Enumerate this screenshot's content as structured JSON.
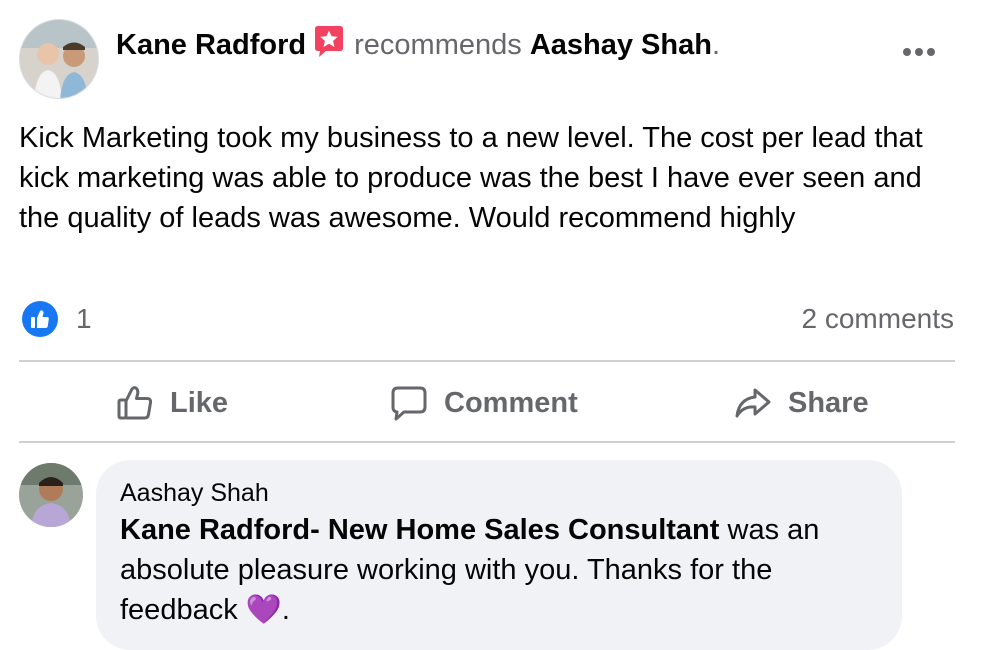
{
  "post": {
    "author": "Kane Radford",
    "verb": "recommends",
    "target": "Aashay Shah",
    "target_suffix": ".",
    "text": "Kick Marketing took my business to a new level. The cost per lead that kick marketing was able to produce was the best I have ever seen and the quality of leads was awesome. Would recommend highly",
    "like_count": "1",
    "comments_count": "2 comments",
    "icons": {
      "avatar": "profile-photo",
      "badge": "recommendation-star-badge-icon",
      "more": "more-options-icon",
      "reaction": "like-reaction-icon"
    }
  },
  "actions": {
    "like": "Like",
    "comment": "Comment",
    "share": "Share"
  },
  "comment": {
    "author": "Aashay Shah",
    "mention": "Kane Radford- New Home Sales Consultant",
    "text": " was an absolute pleasure working with you. Thanks for the feedback ",
    "emoji": "💜",
    "suffix": "."
  },
  "colors": {
    "accent_blue": "#1877f2",
    "badge_red": "#f3425f",
    "muted_text": "#65676b",
    "bubble_bg": "#f0f2f5"
  }
}
